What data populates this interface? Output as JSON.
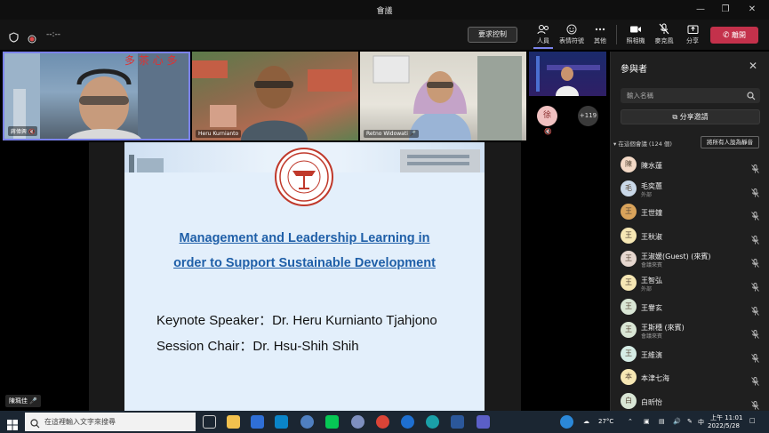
{
  "window": {
    "title": "會議"
  },
  "toolbar": {
    "timer": "--:--",
    "request_control": "要求控制",
    "people": "人員",
    "reactions": "表情符號",
    "more": "其他",
    "camera": "照相機",
    "mic": "麥克風",
    "share": "分享",
    "leave": "離開"
  },
  "videos": [
    {
      "name": "蔣偉興"
    },
    {
      "name": "Heru Kurnianto"
    },
    {
      "name": "Retno Widowati"
    }
  ],
  "overflow": {
    "avatar": "徐",
    "count": "+119"
  },
  "slide": {
    "title_line1": "Management and Leadership Learning in",
    "title_line2": "order to Support Sustainable Development",
    "speaker_line": "Keynote Speaker：Dr. Heru Kurnianto Tjahjono",
    "chair_line": "Session Chair：Dr. Hsu-Shih Shih",
    "logo_text": "TAMKANG UNIVERSITY"
  },
  "presenter": {
    "name": "陳珮佳"
  },
  "participants_panel": {
    "title": "參與者",
    "search_placeholder": "輸入名稱",
    "share_invite": "分享邀請",
    "section_label": "在這個會議 (124 個)",
    "mute_all": "將所有人設為靜音",
    "people": [
      {
        "name": "陳水蓮",
        "sub": "",
        "initial": "陳",
        "color": "#f3d9c6"
      },
      {
        "name": "毛奕蕙",
        "sub": "外部",
        "initial": "毛",
        "color": "#c9d8e8"
      },
      {
        "name": "王世鐘",
        "sub": "",
        "initial": "王",
        "color": "#d9a35b"
      },
      {
        "name": "王秋淑",
        "sub": "",
        "initial": "王",
        "color": "#f6e7b4"
      },
      {
        "name": "王淑媛(Guest) (來賓)",
        "sub": "會議來賓",
        "initial": "王",
        "color": "#e6d7cf"
      },
      {
        "name": "王智弘",
        "sub": "外部",
        "initial": "王",
        "color": "#f6e7b4"
      },
      {
        "name": "王譽玄",
        "sub": "",
        "initial": "王",
        "color": "#d9e6d5"
      },
      {
        "name": "王斯穗 (來賓)",
        "sub": "會議來賓",
        "initial": "王",
        "color": "#d9e6d5"
      },
      {
        "name": "王維演",
        "sub": "",
        "initial": "王",
        "color": "#d5ece5"
      },
      {
        "name": "本津七海",
        "sub": "",
        "initial": "本",
        "color": "#f6e7b4"
      },
      {
        "name": "白昕怡",
        "sub": "",
        "initial": "白",
        "color": "#d9e6d5"
      }
    ]
  },
  "taskbar": {
    "search_placeholder": "在這裡輸入文字來搜尋",
    "weather": "27°C",
    "ime": "中",
    "time": "上午 11:01",
    "date": "2022/5/28"
  },
  "colors": {
    "accent": "#7b83eb",
    "leave": "#c4314b",
    "link_blue": "#1f5fa8"
  }
}
